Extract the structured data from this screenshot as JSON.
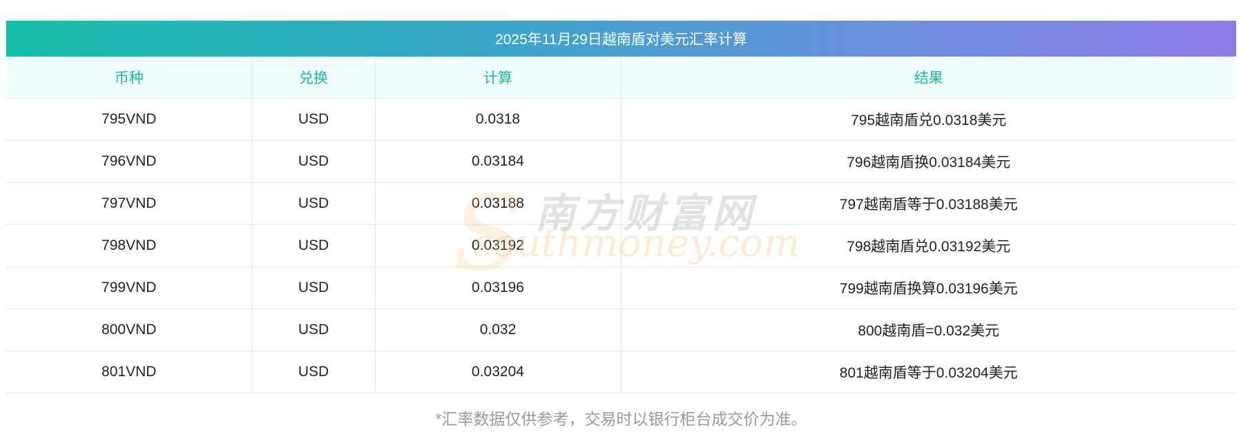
{
  "title": "2025年11月29日越南盾对美元汇率计算",
  "headers": [
    "币种",
    "兑换",
    "计算",
    "结果"
  ],
  "rows": [
    [
      "795VND",
      "USD",
      "0.0318",
      "795越南盾兑0.0318美元"
    ],
    [
      "796VND",
      "USD",
      "0.03184",
      "796越南盾换0.03184美元"
    ],
    [
      "797VND",
      "USD",
      "0.03188",
      "797越南盾等于0.03188美元"
    ],
    [
      "798VND",
      "USD",
      "0.03192",
      "798越南盾兑0.03192美元"
    ],
    [
      "799VND",
      "USD",
      "0.03196",
      "799越南盾换算0.03196美元"
    ],
    [
      "800VND",
      "USD",
      "0.032",
      "800越南盾=0.032美元"
    ],
    [
      "801VND",
      "USD",
      "0.03204",
      "801越南盾等于0.03204美元"
    ]
  ],
  "note": "*汇率数据仅供参考，交易时以银行柜台成交价为准。",
  "watermark": {
    "cn": "南方财富网",
    "en": "southmoney.com"
  },
  "colors": {
    "title_gradient_start": "#16bcaa",
    "title_gradient_end": "#8f7ce6",
    "header_bg": "#effefe",
    "header_text": "#1fb6a3"
  }
}
